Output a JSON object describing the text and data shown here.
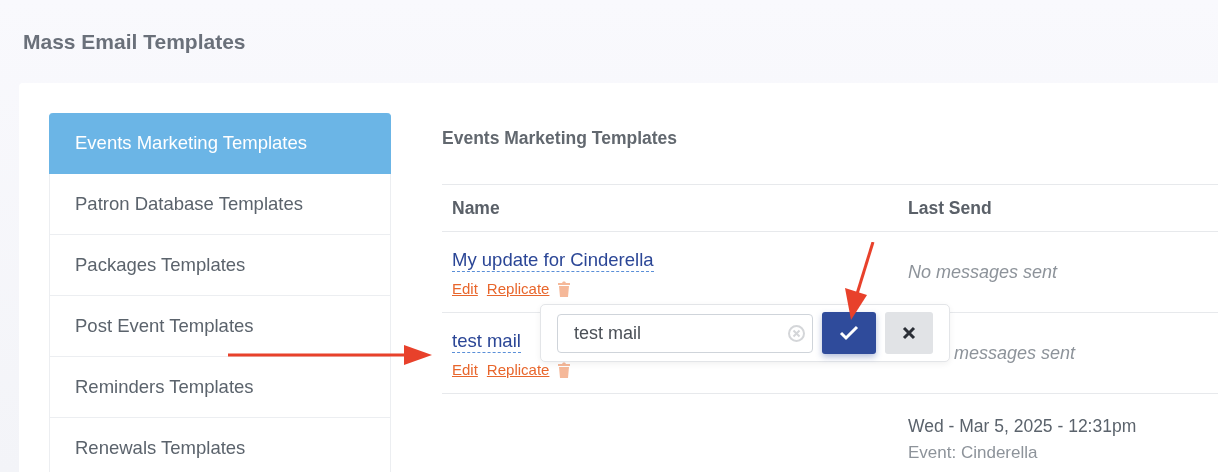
{
  "page_title": "Mass Email Templates",
  "sidebar": {
    "items": [
      {
        "label": "Events Marketing Templates",
        "selected": true
      },
      {
        "label": "Patron Database Templates",
        "selected": false
      },
      {
        "label": "Packages Templates",
        "selected": false
      },
      {
        "label": "Post Event Templates",
        "selected": false
      },
      {
        "label": "Reminders Templates",
        "selected": false
      },
      {
        "label": "Renewals Templates",
        "selected": false
      }
    ]
  },
  "section_title": "Events Marketing Templates",
  "table": {
    "columns": [
      "Name",
      "Last Send"
    ],
    "rows": [
      {
        "name": "My update for Cinderella",
        "actions": [
          "Edit",
          "Replicate"
        ],
        "last_send": "No messages sent",
        "editing": false
      },
      {
        "name": "test mail",
        "actions": [
          "Edit",
          "Replicate"
        ],
        "last_send": "messages sent",
        "editing": true
      },
      {
        "last_send_date": "Wed - Mar 5, 2025 - 12:31pm",
        "last_send_event": "Event: Cinderella",
        "editing": false
      }
    ]
  },
  "rename_popover": {
    "value": "test mail"
  }
}
